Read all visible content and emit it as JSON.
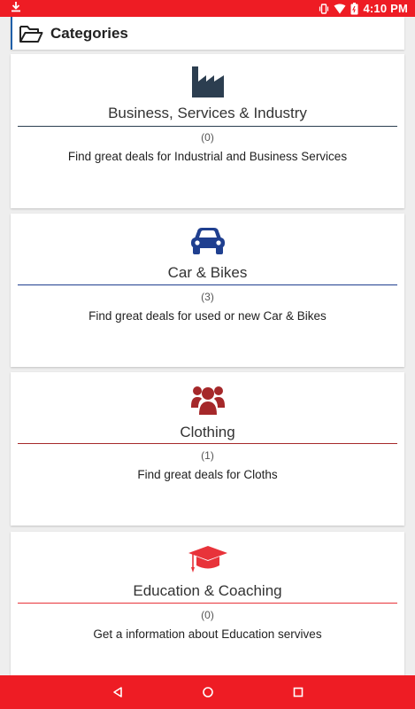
{
  "status_bar": {
    "time": "4:10",
    "ampm": "PM",
    "icons": [
      "download-icon",
      "vibrate-icon",
      "wifi-icon",
      "battery-icon"
    ]
  },
  "header": {
    "title": "Categories",
    "icon": "folder-open-icon"
  },
  "categories": [
    {
      "title": "Business, Services & Industry",
      "count": "(0)",
      "description": "Find great deals for Industrial and Business Services",
      "icon": "factory-icon",
      "color": "#2c3e50"
    },
    {
      "title": "Car & Bikes",
      "count": "(3)",
      "description": "Find great deals for used or new Car & Bikes",
      "icon": "car-icon",
      "color": "#1f3f8f"
    },
    {
      "title": "Clothing",
      "count": "(1)",
      "description": "Find great deals for Cloths",
      "icon": "users-icon",
      "color": "#a5282a"
    },
    {
      "title": "Education & Coaching",
      "count": "(0)",
      "description": "Get a information about Education servives",
      "icon": "graduation-cap-icon",
      "color": "#e8333a"
    }
  ],
  "nav_bar": {
    "buttons": [
      "back-icon",
      "home-icon",
      "recents-icon"
    ]
  },
  "colors": {
    "accent": "#ee1c24",
    "header_border": "#1f5fa8"
  }
}
